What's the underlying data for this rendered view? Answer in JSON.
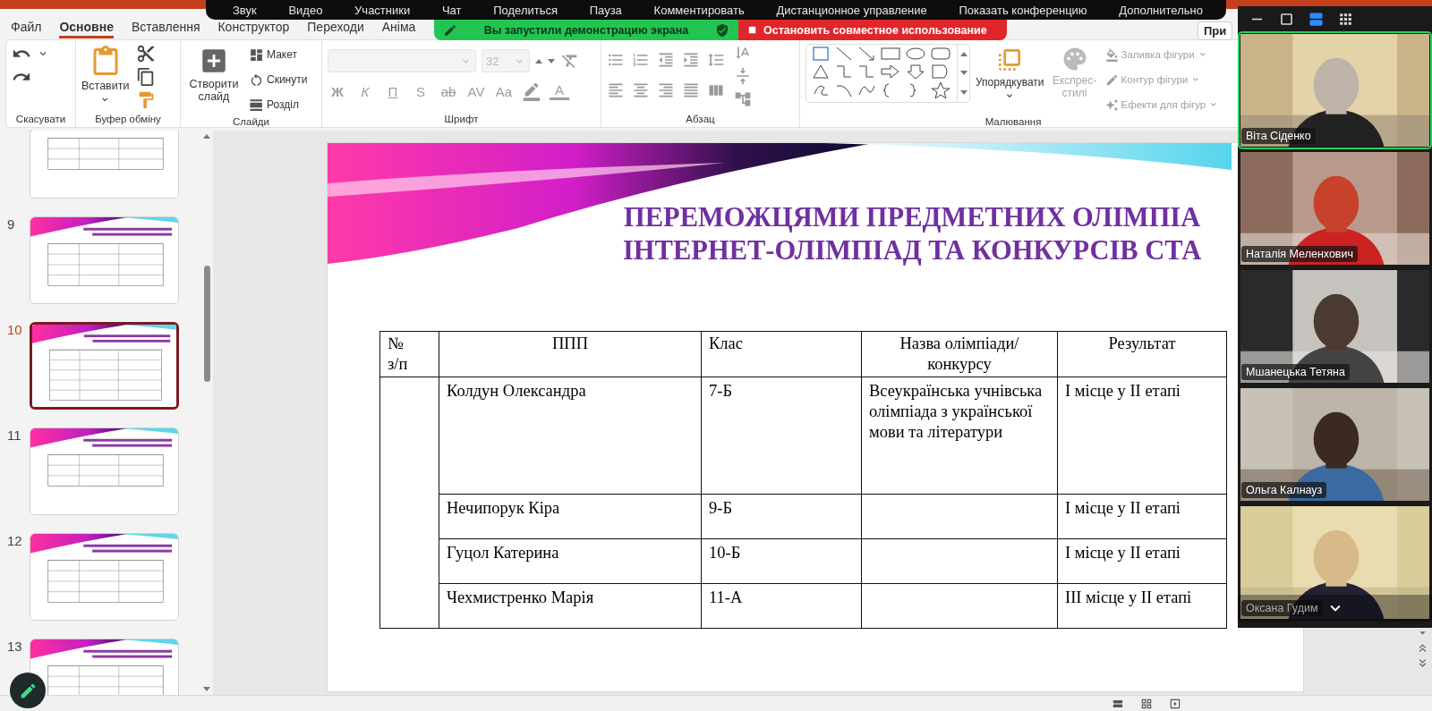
{
  "zoom_toolbar": {
    "items": [
      "Звук",
      "Видео",
      "Участники",
      "Чат",
      "Поделиться",
      "Пауза",
      "Комментировать",
      "Дистанционное управление",
      "Показать конференцию",
      "Дополнительно"
    ]
  },
  "share_banner": {
    "status": "Вы запустили демонстрацию экрана",
    "stop": "Остановить совместное использование"
  },
  "tabs": [
    {
      "label": "Файл",
      "selected": false
    },
    {
      "label": "Основне",
      "selected": true
    },
    {
      "label": "Вставлення",
      "selected": false
    },
    {
      "label": "Конструктор",
      "selected": false
    },
    {
      "label": "Переходи",
      "selected": false
    },
    {
      "label": "Аніма",
      "selected": false
    }
  ],
  "ribbon": {
    "undo": {
      "label": "Скасувати"
    },
    "clipboard": {
      "paste": "Вставити",
      "label": "Буфер обміну"
    },
    "slides": {
      "new_slide": "Створити слайд",
      "items": [
        "Макет",
        "Скинути",
        "Розділ"
      ],
      "label": "Слайди"
    },
    "font": {
      "size": "32",
      "buttons": [
        "Ж",
        "К",
        "П",
        "S",
        "ab",
        "AV",
        "Aa"
      ],
      "color_button": "A",
      "label": "Шрифт"
    },
    "paragraph": {
      "label": "Абзац"
    },
    "drawing": {
      "arrange": "Упорядкувати",
      "styles": "Експрес-стилі",
      "items": [
        "Заливка фігури",
        "Контур фігури",
        "Ефекти для фігур"
      ],
      "label": "Малювання"
    },
    "present_button": "При"
  },
  "slide_panel": {
    "thumbnails": [
      {
        "selected": false
      },
      {
        "number": "9",
        "selected": false
      },
      {
        "number": "10",
        "selected": true
      },
      {
        "number": "11",
        "selected": false
      },
      {
        "number": "12",
        "selected": false
      },
      {
        "number": "13",
        "selected": false
      }
    ]
  },
  "slide": {
    "title": [
      "ПЕРЕМОЖЦЯМИ ПРЕДМЕТНИХ ОЛІМПІА",
      "ІНТЕРНЕТ-ОЛІМПІАД ТА КОНКУРСІВ СТА"
    ],
    "table": {
      "columns": [
        "№ з/п",
        "ППП",
        "Клас",
        "Назва олімпіади/конкурсу",
        "Результат"
      ],
      "rows": [
        {
          "name": "Колдун Олександра",
          "class": "7-Б",
          "contest": "Всеукраїнська учнівська олімпіада з української мови та літератури",
          "result": "І місце у ІІ етапі"
        },
        {
          "name": "Нечипорук Кіра",
          "class": "9-Б",
          "result": "І місце у ІІ етапі"
        },
        {
          "name": "Гуцол Катерина",
          "class": "10-Б",
          "result": "І місце у ІІ етапі"
        },
        {
          "name": "Чехмистренко Марія",
          "class": "11-А",
          "result": "ІІІ місце у ІІ етапі"
        }
      ]
    }
  },
  "video_panel": {
    "views": [
      {
        "kind": "single",
        "selected": false
      },
      {
        "kind": "speaker",
        "selected": true
      },
      {
        "kind": "gallery",
        "selected": false
      }
    ],
    "participants": [
      {
        "name": "Віта Сіденко",
        "active": true
      },
      {
        "name": "Наталія Меленхович",
        "active": false
      },
      {
        "name": "Мшанецька Тетяна",
        "active": false
      },
      {
        "name": "Ольга Калнауз",
        "active": false
      },
      {
        "name": "Оксана Гудим",
        "active": false
      }
    ]
  }
}
